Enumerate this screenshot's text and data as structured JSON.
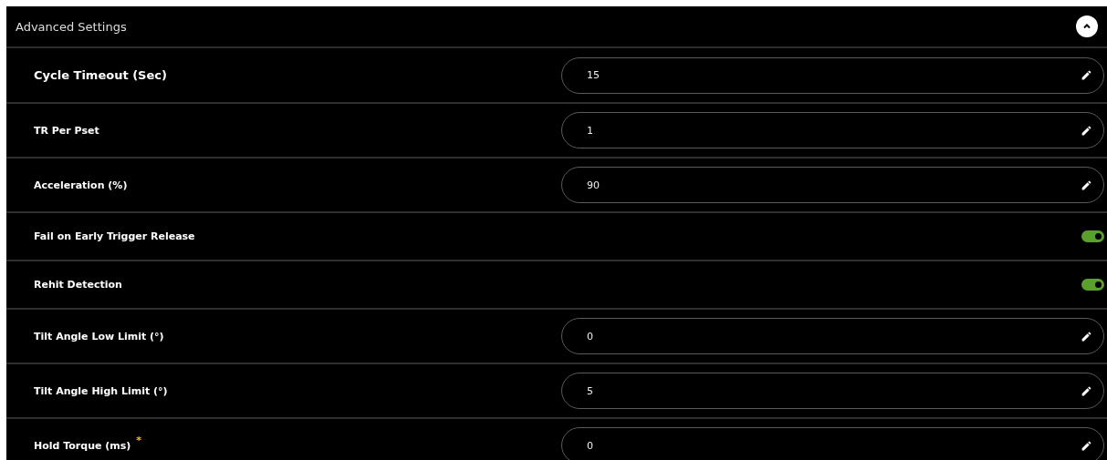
{
  "panel": {
    "title": "Advanced Settings",
    "expanded": true
  },
  "settings": [
    {
      "kind": "field",
      "label": "Cycle Timeout (Sec)",
      "value": "15",
      "emphasized": true
    },
    {
      "kind": "field",
      "label": "TR Per Pset",
      "value": "1",
      "emphasized": false
    },
    {
      "kind": "field",
      "label": "Acceleration (%)",
      "value": "90",
      "emphasized": false
    },
    {
      "kind": "toggle",
      "label": "Fail on Early Trigger Release",
      "on": true,
      "emphasized": false
    },
    {
      "kind": "toggle",
      "label": "Rehit Detection",
      "on": true,
      "emphasized": false
    },
    {
      "kind": "field",
      "label": "Tilt Angle Low Limit (°)",
      "value": "0",
      "emphasized": false
    },
    {
      "kind": "field",
      "label": "Tilt Angle High Limit (°)",
      "value": "5",
      "emphasized": false
    },
    {
      "kind": "field",
      "label": "Hold Torque (ms)",
      "value": "0",
      "emphasized": false,
      "required_mark": "*"
    }
  ]
}
